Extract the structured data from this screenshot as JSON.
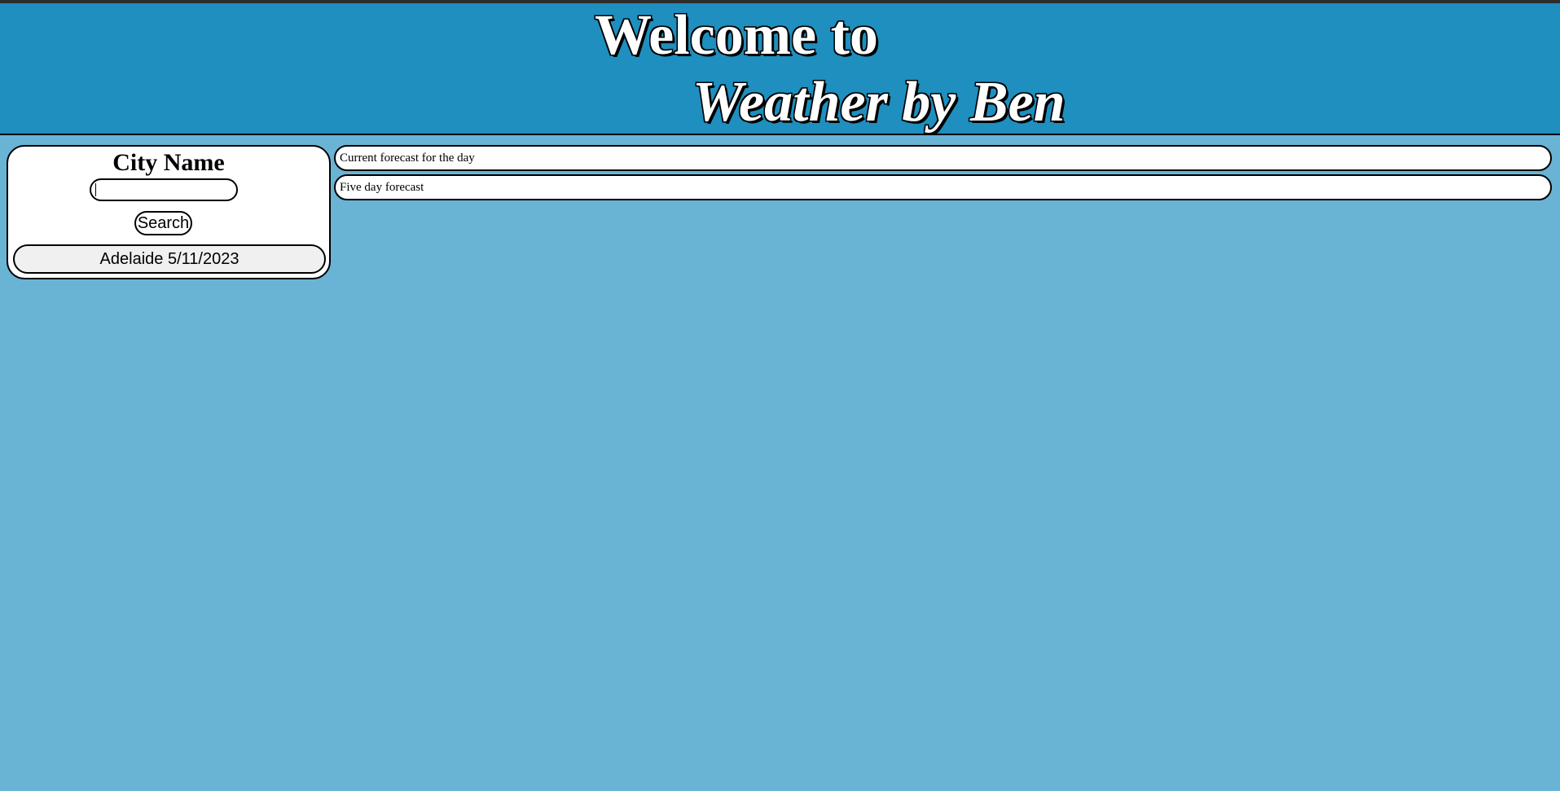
{
  "header": {
    "welcome": "Welcome to",
    "brand": "Weather by Ben"
  },
  "sidebar": {
    "title": "City Name",
    "input_value": "",
    "search_label": "Search",
    "history": [
      {
        "label": "Adelaide 5/11/2023"
      }
    ]
  },
  "main": {
    "current_label": "Current forecast for the day",
    "five_day_label": "Five day forecast"
  },
  "colors": {
    "page_background": "#69b3d4",
    "header_background": "#1e8fbf",
    "panel_background": "#ffffff",
    "history_background": "#f0f0f0",
    "border": "#000000"
  }
}
